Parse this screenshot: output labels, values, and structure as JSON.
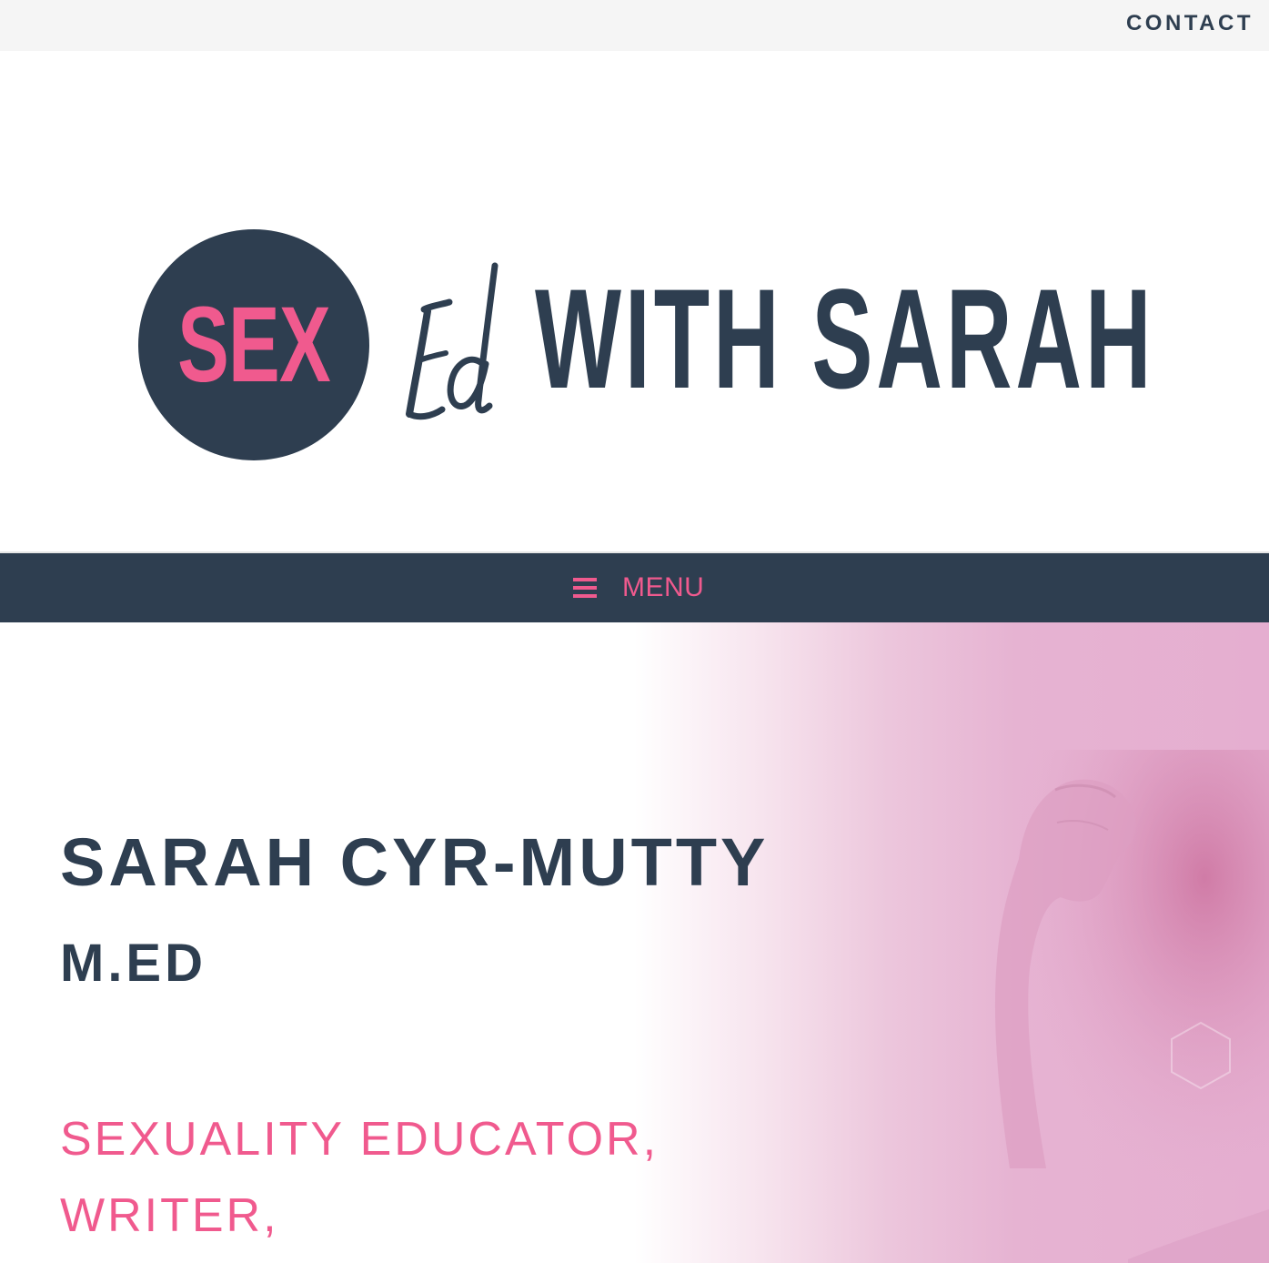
{
  "topbar": {
    "contact_label": "CONTACT"
  },
  "logo": {
    "circle_text": "SEX",
    "script_text": "Ed",
    "rest_text": "WITH SARAH"
  },
  "nav": {
    "menu_label": "MENU",
    "menu_icon": "hamburger-icon"
  },
  "hero": {
    "name": "SARAH CYR-MUTTY",
    "credential": "M.ED",
    "roles": [
      "SEXUALITY EDUCATOR,",
      "WRITER,"
    ]
  },
  "colors": {
    "brand_dark": "#2e3e50",
    "brand_pink": "#f05a8e",
    "topbar_bg": "#f5f5f5"
  }
}
